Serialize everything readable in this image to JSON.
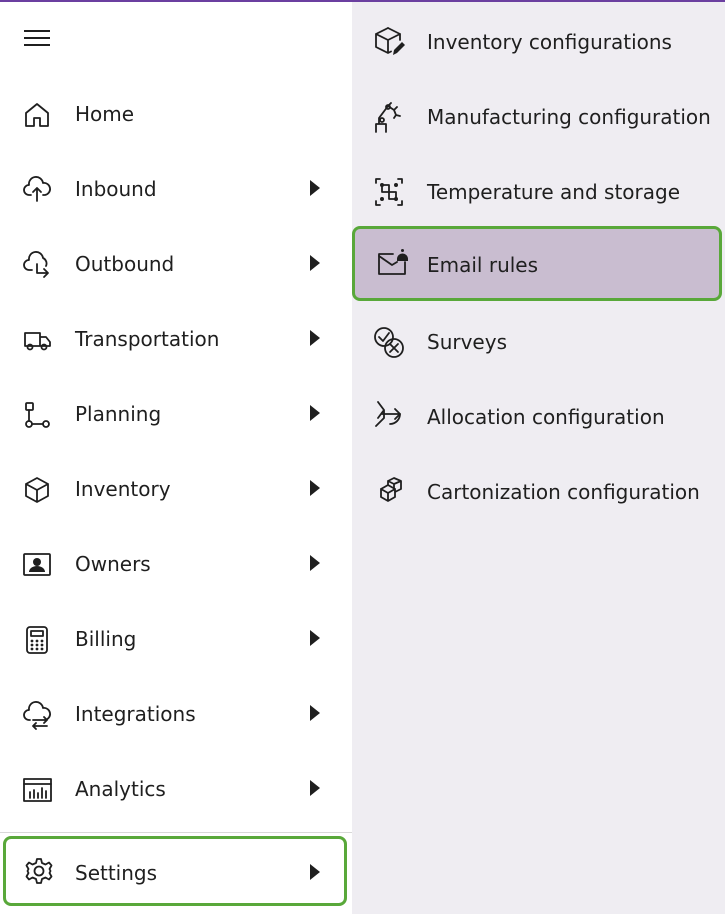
{
  "menu": {
    "hamburger_icon": "hamburger-icon",
    "items": [
      {
        "label": "Home",
        "icon": "home-icon",
        "has_submenu": false
      },
      {
        "label": "Inbound",
        "icon": "inbound-icon",
        "has_submenu": true
      },
      {
        "label": "Outbound",
        "icon": "outbound-icon",
        "has_submenu": true
      },
      {
        "label": "Transportation",
        "icon": "truck-icon",
        "has_submenu": true
      },
      {
        "label": "Planning",
        "icon": "planning-icon",
        "has_submenu": true
      },
      {
        "label": "Inventory",
        "icon": "box-icon",
        "has_submenu": true
      },
      {
        "label": "Owners",
        "icon": "owner-card-icon",
        "has_submenu": true
      },
      {
        "label": "Billing",
        "icon": "calculator-icon",
        "has_submenu": true
      },
      {
        "label": "Integrations",
        "icon": "cloud-sync-icon",
        "has_submenu": true
      },
      {
        "label": "Analytics",
        "icon": "chart-icon",
        "has_submenu": true
      },
      {
        "label": "Settings",
        "icon": "gear-icon",
        "has_submenu": true,
        "highlighted": true
      }
    ]
  },
  "submenu": {
    "items": [
      {
        "label": "Inventory configurations",
        "icon": "box-edit-icon"
      },
      {
        "label": "Manufacturing configuration",
        "icon": "robot-arm-icon"
      },
      {
        "label": "Temperature and storage",
        "icon": "storage-grid-icon"
      },
      {
        "label": "Email rules",
        "icon": "mail-alert-icon",
        "selected": true
      },
      {
        "label": "Surveys",
        "icon": "check-cancel-icon"
      },
      {
        "label": "Allocation configuration",
        "icon": "allocation-arrow-icon"
      },
      {
        "label": "Cartonization configuration",
        "icon": "boxes-icon"
      }
    ]
  },
  "colors": {
    "accent_top_line": "#6b3fa0",
    "highlight_border": "#59a83a",
    "submenu_background": "#efedf2",
    "selected_background": "#c9bdd0"
  }
}
